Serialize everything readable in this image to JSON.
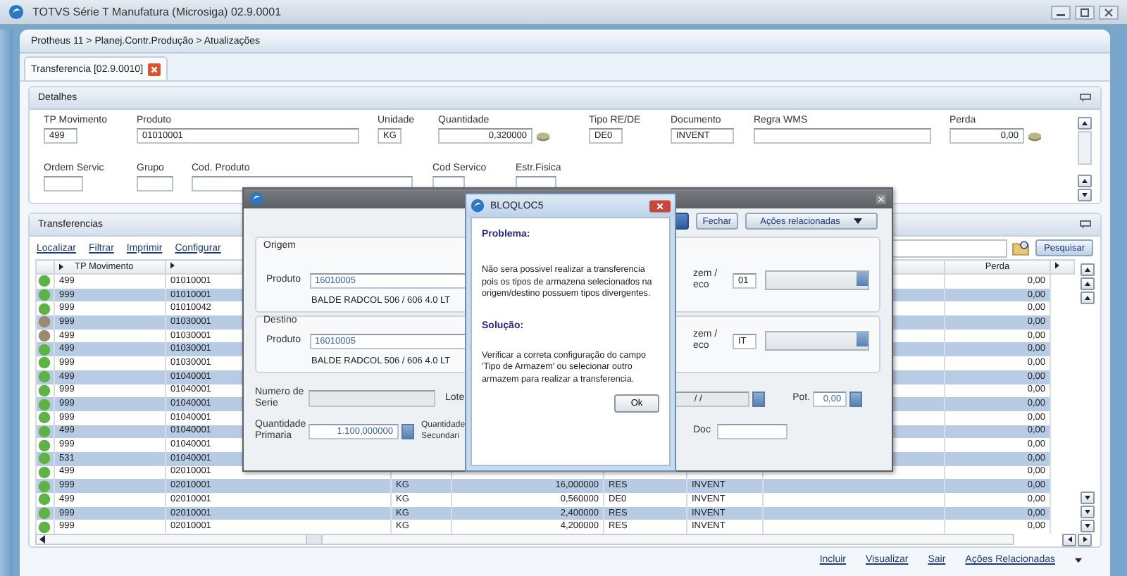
{
  "window": {
    "title": "TOTVS Série T Manufatura (Microsiga) 02.9.0001"
  },
  "breadcrumb": "Protheus 11 > Planej.Contr.Produção > Atualizações",
  "tab": {
    "label": "Transferencia [02.9.0010]"
  },
  "details": {
    "title": "Detalhes",
    "row1": [
      {
        "label": "TP Movimento",
        "value": "499",
        "kind": "text"
      },
      {
        "label": "Produto",
        "value": "01010001",
        "kind": "text"
      },
      {
        "label": "Unidade",
        "value": "KG",
        "kind": "text"
      },
      {
        "label": "Quantidade",
        "value": "0,320000",
        "kind": "lookup"
      },
      {
        "label": "Tipo RE/DE",
        "value": "DE0",
        "kind": "text"
      },
      {
        "label": "Documento",
        "value": "INVENT",
        "kind": "text"
      },
      {
        "label": "Regra WMS",
        "kind": "text"
      },
      {
        "label": "Perda",
        "value": "0,00",
        "kind": "lookup"
      }
    ],
    "row2": [
      {
        "label": "Ordem Servic"
      },
      {
        "label": "Grupo"
      },
      {
        "label": "Cod. Produto"
      },
      {
        "label": "Cod Servico"
      },
      {
        "label": "Estr.Fisica"
      }
    ]
  },
  "transfers": {
    "title": "Transferencias",
    "actions": [
      "Localizar",
      "Filtrar",
      "Imprimir",
      "Configurar"
    ],
    "search_button": "Pesquisar",
    "columns": {
      "tp": "TP Movimento",
      "perda": "Perda"
    },
    "rows": [
      {
        "color": "#5db344",
        "tp": "499",
        "produto": "01010001",
        "perda": "0,00"
      },
      {
        "color": "#5db344",
        "tp": "999",
        "produto": "01010001",
        "perda": "0,00"
      },
      {
        "color": "#5db344",
        "tp": "999",
        "produto": "01010042",
        "perda": "0,00"
      },
      {
        "color": "#9a8a72",
        "tp": "999",
        "produto": "01030001",
        "perda": "0,00"
      },
      {
        "color": "#9a8a72",
        "tp": "499",
        "produto": "01030001",
        "perda": "0,00"
      },
      {
        "color": "#5db344",
        "tp": "499",
        "produto": "01030001",
        "perda": "0,00"
      },
      {
        "color": "#5db344",
        "tp": "999",
        "produto": "01030001",
        "perda": "0,00"
      },
      {
        "color": "#5db344",
        "tp": "499",
        "produto": "01040001",
        "perda": "0,00"
      },
      {
        "color": "#5db344",
        "tp": "999",
        "produto": "01040001",
        "perda": "0,00"
      },
      {
        "color": "#5db344",
        "tp": "999",
        "produto": "01040001",
        "perda": "0,00"
      },
      {
        "color": "#5db344",
        "tp": "999",
        "produto": "01040001",
        "perda": "0,00"
      },
      {
        "color": "#5db344",
        "tp": "499",
        "produto": "01040001",
        "perda": "0,00"
      },
      {
        "color": "#5db344",
        "tp": "999",
        "produto": "01040001",
        "perda": "0,00"
      },
      {
        "color": "#5db344",
        "tp": "531",
        "produto": "01040001",
        "perda": "0,00"
      },
      {
        "color": "#5db344",
        "tp": "499",
        "produto": "02010001",
        "perda": "0,00"
      },
      {
        "color": "#5db344",
        "tp": "999",
        "produto": "02010001",
        "unidade": "KG",
        "quantidade": "16,000000",
        "armazem": "RES",
        "documento": "INVENT",
        "perda": "0,00"
      },
      {
        "color": "#5db344",
        "tp": "499",
        "produto": "02010001",
        "unidade": "KG",
        "quantidade": "0,560000",
        "armazem": "DE0",
        "documento": "INVENT",
        "perda": "0,00"
      },
      {
        "color": "#5db344",
        "tp": "999",
        "produto": "02010001",
        "unidade": "KG",
        "quantidade": "2,400000",
        "armazem": "RES",
        "documento": "INVENT",
        "perda": "0,00"
      },
      {
        "color": "#5db344",
        "tp": "999",
        "produto": "02010001",
        "unidade": "KG",
        "quantidade": "4,200000",
        "armazem": "RES",
        "documento": "INVENT",
        "perda": "0,00"
      }
    ],
    "footer_links": [
      "Incluir",
      "Visualizar",
      "Sair",
      "Ações Relacionadas"
    ]
  },
  "transfer_dialog": {
    "buttons": [
      "Fechar",
      "Ações relacionadas"
    ],
    "groups": [
      {
        "legend": "Origem",
        "product_label": "Produto",
        "product": "16010005",
        "description": "BALDE RADCOL 506 / 606 4.0 LT",
        "store_label_lines": [
          "zem /",
          "eco"
        ],
        "store": "01"
      },
      {
        "legend": "Destino",
        "product_label": "Produto",
        "product": "16010005",
        "description": "BALDE RADCOL 506 / 606 4.0 LT",
        "store_label_lines": [
          "zem /",
          "eco"
        ],
        "store": "IT"
      }
    ],
    "serial_label": "Numero de Serie",
    "lot_label": "Lote",
    "lot_date": "/ /",
    "pot_label": "Pot.",
    "pot": "0,00",
    "qty_primary_label": "Quantidade Primaria",
    "qty_primary": "1.100,000000",
    "qty_secondary_label": "Quantidade Secundari",
    "doc_label": "Doc"
  },
  "message_dialog": {
    "title": "BLOQLOC5",
    "problem_heading": "Problema:",
    "problem": "Não sera possivel realizar a transferencia pois os tipos de armazena selecionados na origem/destino possuem tipos divergentes.",
    "solution_heading": "Solução:",
    "solution": "Verificar a correta configuração do campo 'Tipo de Armazem' ou selecionar outro armazem para realizar a transferencia.",
    "ok": "Ok"
  }
}
